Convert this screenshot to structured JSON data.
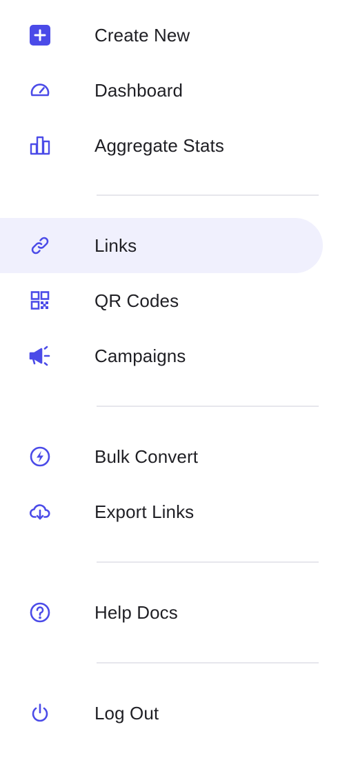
{
  "theme": {
    "accent": "#4b4be8",
    "active_bg": "#f0f0fd",
    "text": "#1f1f24",
    "divider": "#e6e6ec"
  },
  "menu": {
    "create_new": {
      "label": "Create New",
      "icon": "plus-square-icon"
    },
    "dashboard": {
      "label": "Dashboard",
      "icon": "speedometer-icon"
    },
    "aggregate_stats": {
      "label": "Aggregate Stats",
      "icon": "bar-chart-icon"
    },
    "links": {
      "label": "Links",
      "icon": "link-icon",
      "active": true
    },
    "qr_codes": {
      "label": "QR Codes",
      "icon": "qr-code-icon"
    },
    "campaigns": {
      "label": "Campaigns",
      "icon": "megaphone-icon"
    },
    "bulk_convert": {
      "label": "Bulk Convert",
      "icon": "lightning-icon"
    },
    "export_links": {
      "label": "Export Links",
      "icon": "cloud-download-icon"
    },
    "help_docs": {
      "label": "Help Docs",
      "icon": "question-circle-icon"
    },
    "log_out": {
      "label": "Log Out",
      "icon": "power-icon"
    }
  }
}
